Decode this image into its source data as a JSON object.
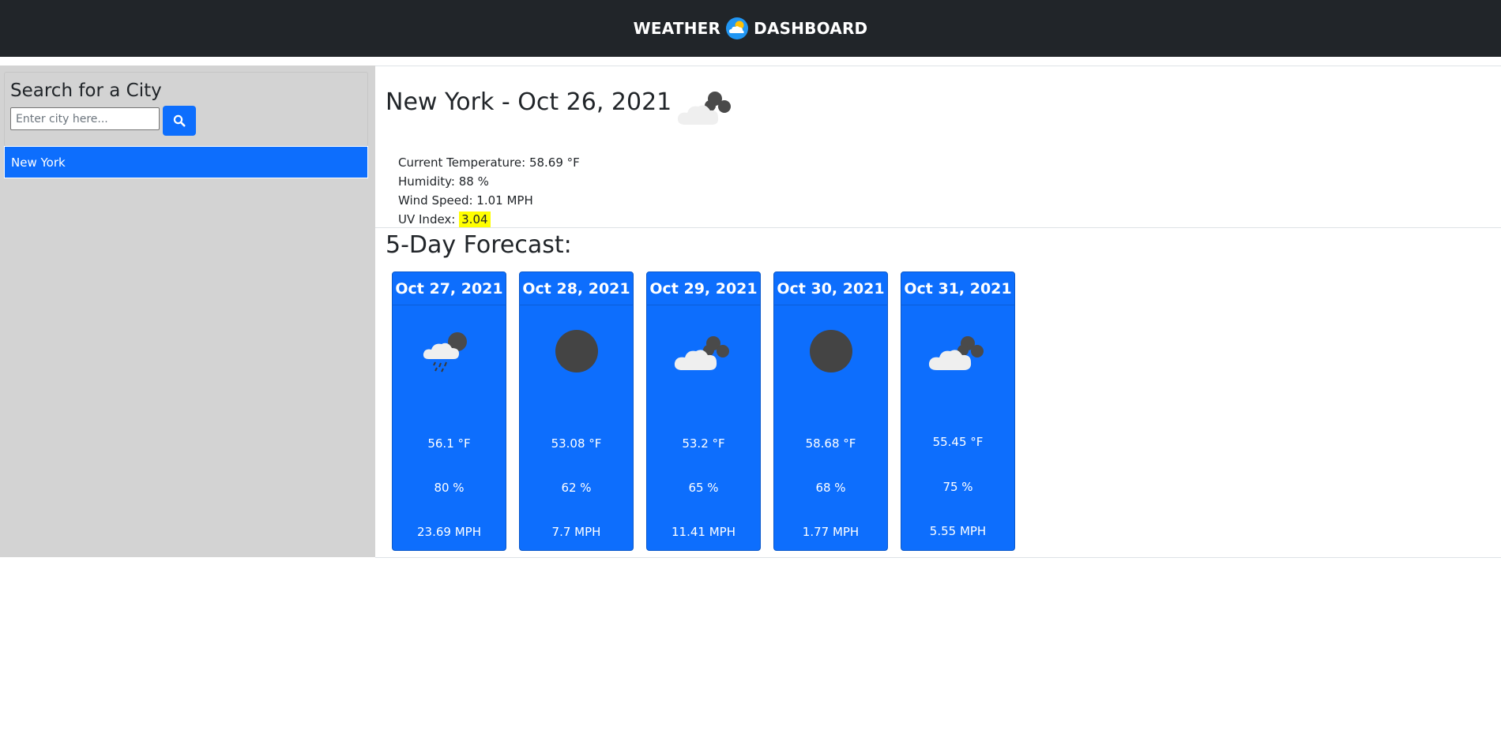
{
  "header": {
    "title_left": "WEATHER",
    "title_right": "DASHBOARD",
    "logo_icon": "sun-cloud-icon"
  },
  "sidebar": {
    "title": "Search for a City",
    "search": {
      "placeholder": "Enter city here...",
      "value": "",
      "button_icon": "search-icon"
    },
    "history": [
      "New York"
    ]
  },
  "current": {
    "city": "New York",
    "date": "Oct 26, 2021",
    "title": "New York - Oct 26, 2021",
    "icon": "partly-cloudy-icon",
    "temperature_label": "Current Temperature: 58.69 °F",
    "humidity_label": "Humidity: 88 %",
    "wind_label": "Wind Speed: 1.01 MPH",
    "uv_label": "UV Index:",
    "uv_value": "3.04",
    "uv_color": "#ffff00"
  },
  "forecast": {
    "title": "5-Day Forecast:",
    "days": [
      {
        "date": "Oct 27, 2021",
        "icon": "rain-cloud-icon",
        "temp": "56.1 °F",
        "humidity": "80 %",
        "wind": "23.69 MPH"
      },
      {
        "date": "Oct 28, 2021",
        "icon": "dark-circle-icon",
        "temp": "53.08 °F",
        "humidity": "62 %",
        "wind": "7.7 MPH"
      },
      {
        "date": "Oct 29, 2021",
        "icon": "partly-cloudy-icon",
        "temp": "53.2 °F",
        "humidity": "65 %",
        "wind": "11.41 MPH"
      },
      {
        "date": "Oct 30, 2021",
        "icon": "dark-circle-icon",
        "temp": "58.68 °F",
        "humidity": "68 %",
        "wind": "1.77 MPH"
      },
      {
        "date": "Oct 31, 2021",
        "icon": "partly-cloudy-icon",
        "temp": "55.45 °F",
        "humidity": "75 %",
        "wind": "5.55 MPH"
      }
    ]
  },
  "colors": {
    "navbar": "#212529",
    "accent": "#0d6efd",
    "sidebar": "#d3d3d3",
    "uv_highlight": "#ffff00"
  }
}
